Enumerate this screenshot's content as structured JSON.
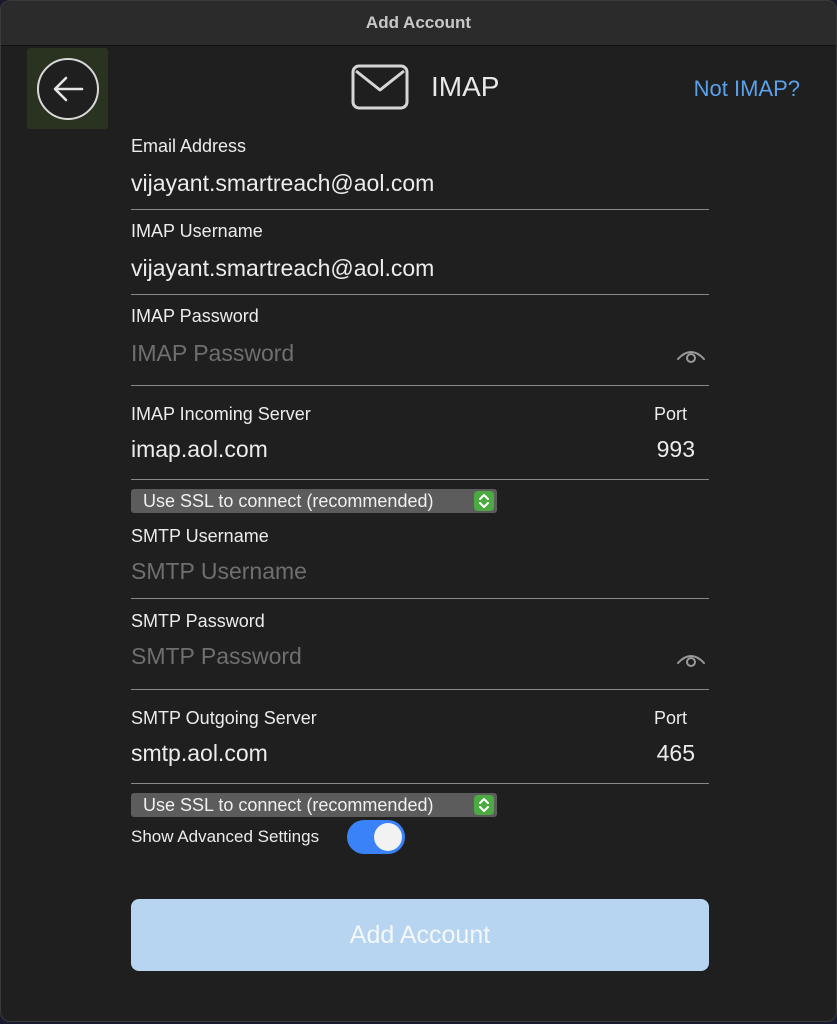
{
  "window": {
    "title": "Add Account"
  },
  "header": {
    "title": "IMAP",
    "not_imap_link": "Not IMAP?",
    "back_icon": "arrow-left-circle-icon",
    "mail_icon": "envelope-icon"
  },
  "fields": {
    "email": {
      "label": "Email Address",
      "value": "vijayant.smartreach@aol.com"
    },
    "imap_username": {
      "label": "IMAP Username",
      "value": "vijayant.smartreach@aol.com"
    },
    "imap_password": {
      "label": "IMAP Password",
      "placeholder": "IMAP Password"
    },
    "imap_server": {
      "label": "IMAP Incoming Server",
      "value": "imap.aol.com",
      "port_label": "Port",
      "port_value": "993"
    },
    "imap_ssl": {
      "selected": "Use SSL to connect (recommended)"
    },
    "smtp_username": {
      "label": "SMTP Username",
      "placeholder": "SMTP Username"
    },
    "smtp_password": {
      "label": "SMTP Password",
      "placeholder": "SMTP Password"
    },
    "smtp_server": {
      "label": "SMTP Outgoing Server",
      "value": "smtp.aol.com",
      "port_label": "Port",
      "port_value": "465"
    },
    "smtp_ssl": {
      "selected": "Use SSL to connect (recommended)"
    }
  },
  "advanced": {
    "label": "Show Advanced Settings",
    "enabled": true
  },
  "submit": {
    "label": "Add Account"
  },
  "colors": {
    "accent_link": "#5aa1ea",
    "toggle_on": "#3a82f7",
    "select_stepper": "#4caa43",
    "button_disabled": "#b7d5f0"
  }
}
